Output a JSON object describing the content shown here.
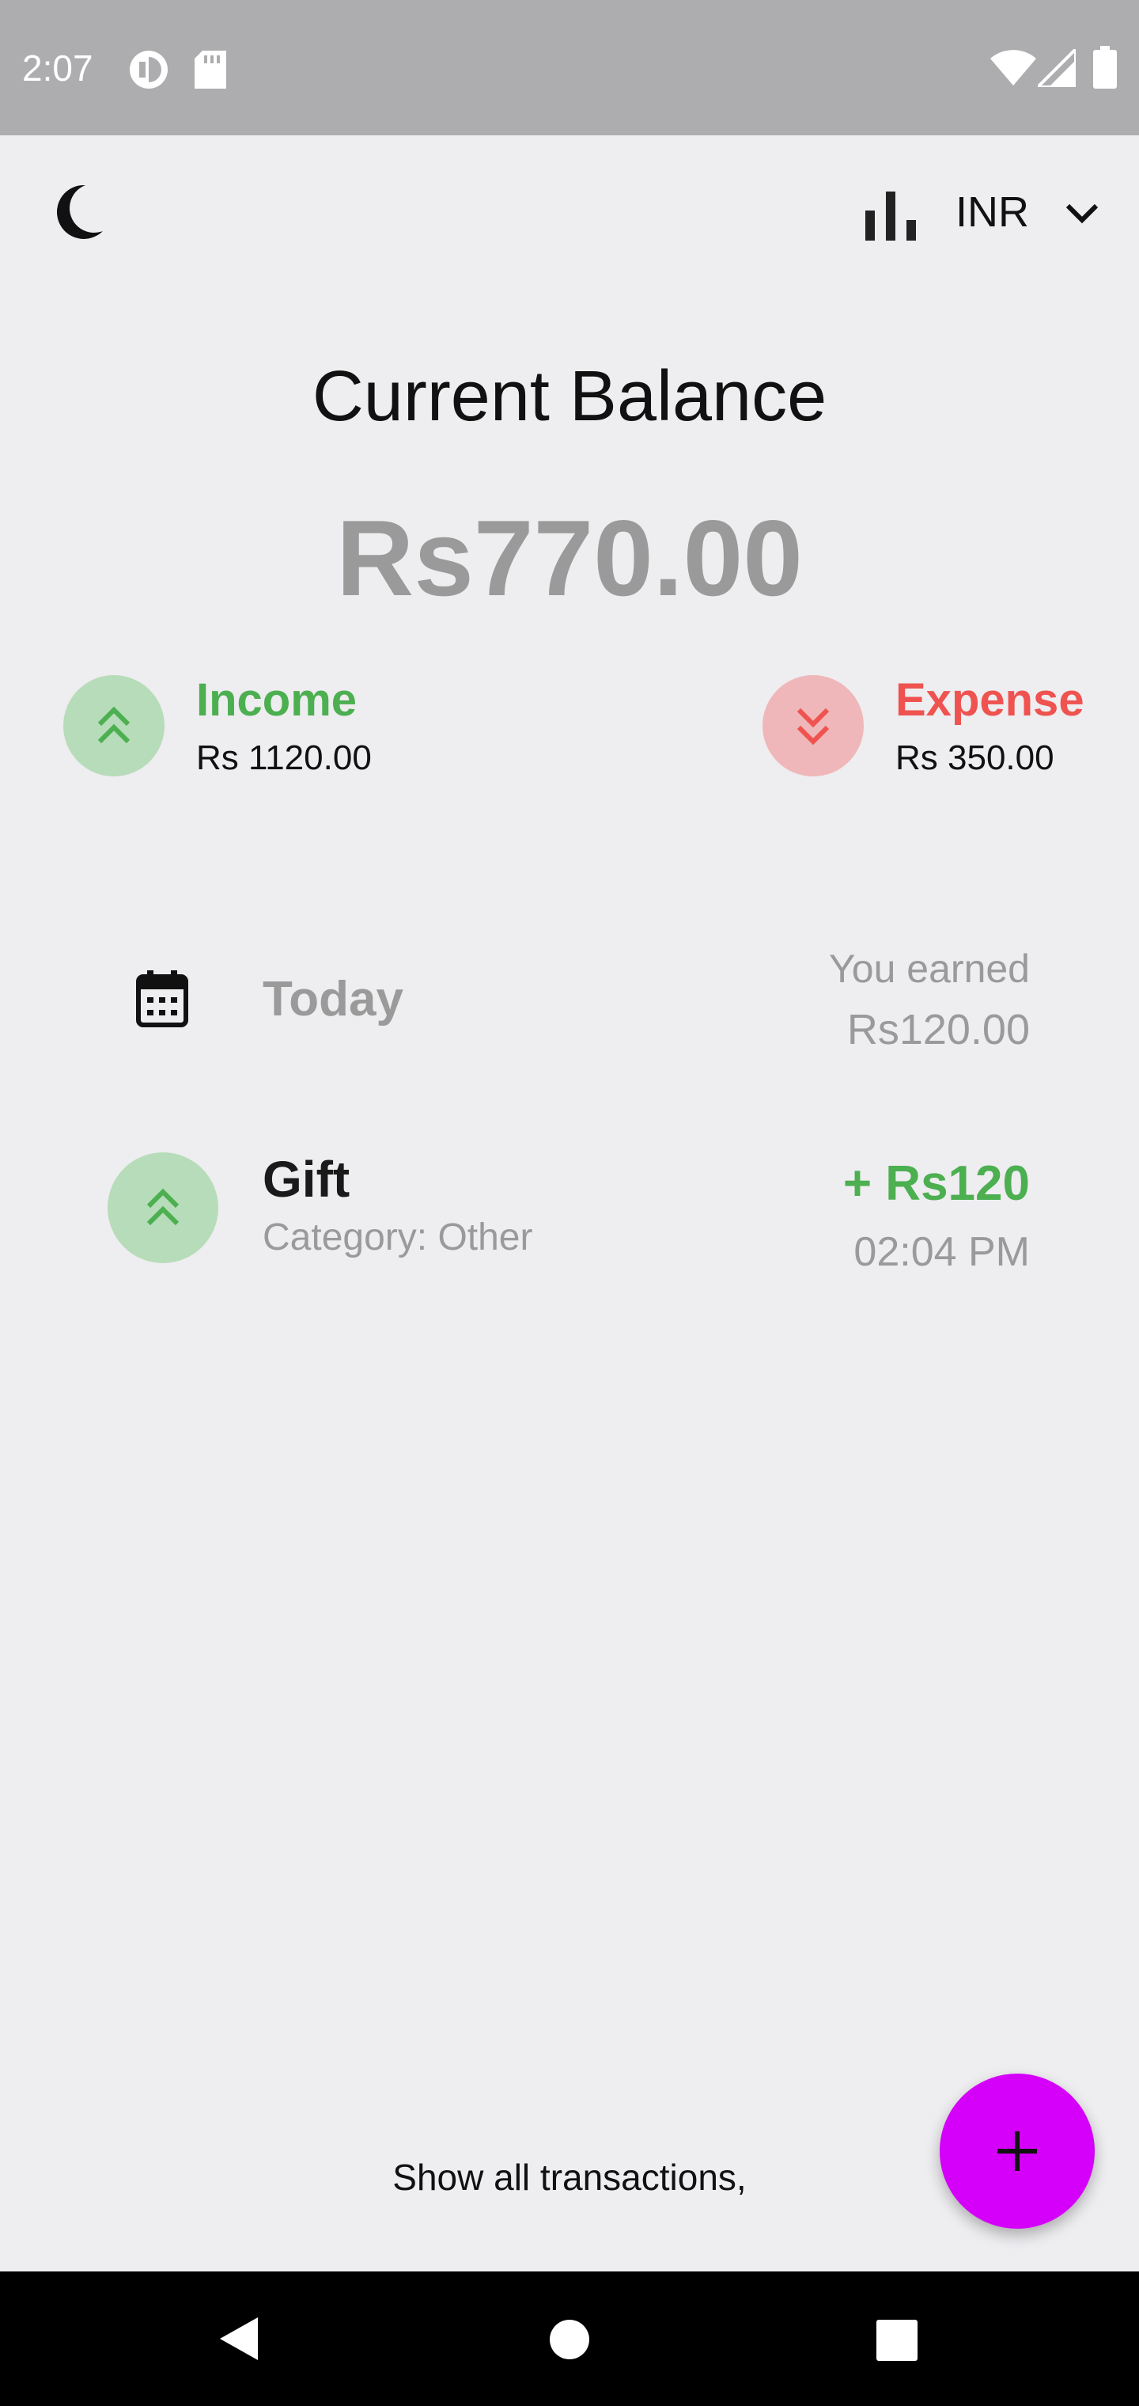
{
  "status_bar": {
    "time": "2:07",
    "icons": [
      "data-saver-icon",
      "sd-card-icon",
      "wifi-icon",
      "cell-signal-icon",
      "battery-icon"
    ]
  },
  "app_bar": {
    "theme_icon": "moon-icon",
    "stats_icon": "bar-chart-icon",
    "currency": "INR",
    "dropdown_icon": "chevron-down-icon"
  },
  "balance": {
    "title": "Current Balance",
    "amount": "Rs770.00"
  },
  "summary": {
    "income": {
      "label": "Income",
      "amount": "Rs 1120.00",
      "color": "#4caf50",
      "bg": "#b7dcb9",
      "icon": "double-chevron-up-icon"
    },
    "expense": {
      "label": "Expense",
      "amount": "Rs 350.00",
      "color": "#ef5350",
      "bg": "#efb7b9",
      "icon": "double-chevron-down-icon"
    }
  },
  "day_group": {
    "icon": "calendar-icon",
    "label": "Today",
    "earned_label": "You earned",
    "earned_amount": "Rs120.00"
  },
  "transactions": [
    {
      "icon": "double-chevron-up-icon",
      "name": "Gift",
      "category": "Category: Other",
      "amount": "+ Rs120",
      "time": "02:04 PM"
    }
  ],
  "footer": {
    "show_all": "Show all transactions,"
  },
  "fab": {
    "icon": "plus-icon",
    "color": "#d500f9"
  },
  "nav_bar": {
    "icons": [
      "back-icon",
      "home-icon",
      "recents-icon"
    ]
  }
}
